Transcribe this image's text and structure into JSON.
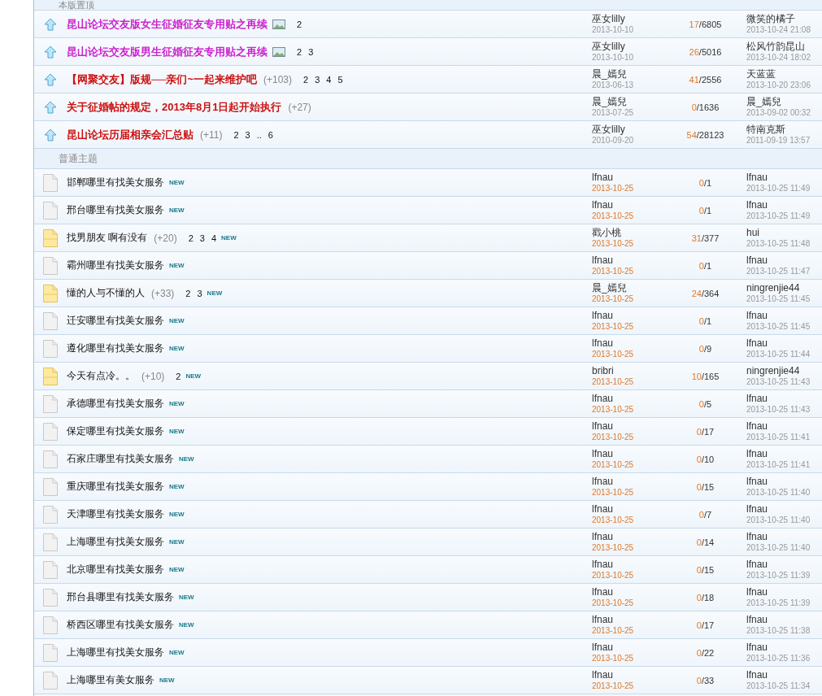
{
  "sections": [
    {
      "kind": "sticky",
      "title": "本版置顶",
      "threads": [
        {
          "kind": "sticky",
          "title": "昆山论坛交友版女生征婚征友专用贴之再续",
          "color": "#cc22cc",
          "attachment": true,
          "pages": [
            "2"
          ],
          "author": "巫女lilly",
          "author_date": "2013-10-10",
          "replies": "17",
          "views": "/6805",
          "last_poster": "微笑的橘子",
          "last_date": "2013-10-24 21:08"
        },
        {
          "kind": "sticky",
          "title": "昆山论坛交友版男生征婚征友专用贴之再续",
          "color": "#cc22cc",
          "attachment": true,
          "pages": [
            "2",
            "3"
          ],
          "author": "巫女lilly",
          "author_date": "2013-10-10",
          "replies": "26",
          "views": "/5016",
          "last_poster": "松风竹韵昆山",
          "last_date": "2013-10-24 18:02"
        },
        {
          "kind": "sticky",
          "title": "【网聚交友】版规──亲们~一起来维护吧",
          "color": "#cc1111",
          "attachment": false,
          "extra": "(+103)",
          "pages": [
            "2",
            "3",
            "4",
            "5"
          ],
          "author": "晨_嫣兒",
          "author_date": "2013-06-13",
          "replies": "41",
          "views": "/2556",
          "last_poster": "天蓝蓝",
          "last_date": "2013-10-20 23:06"
        },
        {
          "kind": "sticky",
          "title": "关于征婚帖的规定，2013年8月1日起开始执行",
          "color": "#cc1111",
          "attachment": false,
          "extra": "(+27)",
          "author": "晨_嫣兒",
          "author_date": "2013-07-25",
          "replies": "0",
          "views": "/1636",
          "last_poster": "晨_嫣兒",
          "last_date": "2013-09-02 00:32"
        },
        {
          "kind": "sticky",
          "title": "昆山论坛历届相亲会汇总贴",
          "color": "#cc1111",
          "attachment": false,
          "extra": "(+11)",
          "pages": [
            "2",
            "3",
            "..",
            "6"
          ],
          "author": "巫女lilly",
          "author_date": "2010-09-20",
          "replies": "54",
          "views": "/28123",
          "last_poster": "特南克斯",
          "last_date": "2011-09-19 13:57"
        }
      ]
    },
    {
      "kind": "normal",
      "title": "普通主题",
      "threads": [
        {
          "kind": "normal",
          "title": "邯郸哪里有找美女服务",
          "badge": "NEW",
          "author": "lfnau",
          "author_date": "2013-10-25",
          "replies": "0",
          "views": "/1",
          "last_poster": "lfnau",
          "last_date": "2013-10-25 11:49"
        },
        {
          "kind": "normal",
          "title": "邢台哪里有找美女服务",
          "badge": "NEW",
          "author": "lfnau",
          "author_date": "2013-10-25",
          "replies": "0",
          "views": "/1",
          "last_poster": "lfnau",
          "last_date": "2013-10-25 11:49"
        },
        {
          "kind": "hot",
          "title": "找男朋友 啊有没有",
          "extra": "(+20)",
          "pages": [
            "2",
            "3",
            "4"
          ],
          "badge": "NEW",
          "author": "戳小桃",
          "author_date": "2013-10-25",
          "replies": "31",
          "views": "/377",
          "last_poster": "hui",
          "last_date": "2013-10-25 11:48"
        },
        {
          "kind": "normal",
          "title": "霸州哪里有找美女服务",
          "badge": "NEW",
          "author": "lfnau",
          "author_date": "2013-10-25",
          "replies": "0",
          "views": "/1",
          "last_poster": "lfnau",
          "last_date": "2013-10-25 11:47"
        },
        {
          "kind": "hot",
          "title": "懂的人与不懂的人",
          "extra": "(+33)",
          "pages": [
            "2",
            "3"
          ],
          "badge": "NEW",
          "author": "晨_嫣兒",
          "author_date": "2013-10-25",
          "replies": "24",
          "views": "/364",
          "last_poster": "ningrenjie44",
          "last_date": "2013-10-25 11:45"
        },
        {
          "kind": "normal",
          "title": "迁安哪里有找美女服务",
          "badge": "NEW",
          "author": "lfnau",
          "author_date": "2013-10-25",
          "replies": "0",
          "views": "/1",
          "last_poster": "lfnau",
          "last_date": "2013-10-25 11:45"
        },
        {
          "kind": "normal",
          "title": "遵化哪里有找美女服务",
          "badge": "NEW",
          "author": "lfnau",
          "author_date": "2013-10-25",
          "replies": "0",
          "views": "/9",
          "last_poster": "lfnau",
          "last_date": "2013-10-25 11:44"
        },
        {
          "kind": "hot",
          "title": "今天有点冷。。",
          "extra": "(+10)",
          "pages": [
            "2"
          ],
          "badge": "NEW",
          "author": "bribri",
          "author_date": "2013-10-25",
          "replies": "10",
          "views": "/165",
          "last_poster": "ningrenjie44",
          "last_date": "2013-10-25 11:43"
        },
        {
          "kind": "normal",
          "title": "承德哪里有找美女服务",
          "badge": "NEW",
          "author": "lfnau",
          "author_date": "2013-10-25",
          "replies": "0",
          "views": "/5",
          "last_poster": "lfnau",
          "last_date": "2013-10-25 11:43"
        },
        {
          "kind": "normal",
          "title": "保定哪里有找美女服务",
          "badge": "NEW",
          "author": "lfnau",
          "author_date": "2013-10-25",
          "replies": "0",
          "views": "/17",
          "last_poster": "lfnau",
          "last_date": "2013-10-25 11:41"
        },
        {
          "kind": "normal",
          "title": "石家庄哪里有找美女服务",
          "badge": "NEW",
          "author": "lfnau",
          "author_date": "2013-10-25",
          "replies": "0",
          "views": "/10",
          "last_poster": "lfnau",
          "last_date": "2013-10-25 11:41"
        },
        {
          "kind": "normal",
          "title": "重庆哪里有找美女服务",
          "badge": "NEW",
          "author": "lfnau",
          "author_date": "2013-10-25",
          "replies": "0",
          "views": "/15",
          "last_poster": "lfnau",
          "last_date": "2013-10-25 11:40"
        },
        {
          "kind": "normal",
          "title": "天津哪里有找美女服务",
          "badge": "NEW",
          "author": "lfnau",
          "author_date": "2013-10-25",
          "replies": "0",
          "views": "/7",
          "last_poster": "lfnau",
          "last_date": "2013-10-25 11:40"
        },
        {
          "kind": "normal",
          "title": "上海哪里有找美女服务",
          "badge": "NEW",
          "author": "lfnau",
          "author_date": "2013-10-25",
          "replies": "0",
          "views": "/14",
          "last_poster": "lfnau",
          "last_date": "2013-10-25 11:40"
        },
        {
          "kind": "normal",
          "title": "北京哪里有找美女服务",
          "badge": "NEW",
          "author": "lfnau",
          "author_date": "2013-10-25",
          "replies": "0",
          "views": "/15",
          "last_poster": "lfnau",
          "last_date": "2013-10-25 11:39"
        },
        {
          "kind": "normal",
          "title": "邢台县哪里有找美女服务",
          "badge": "NEW",
          "author": "lfnau",
          "author_date": "2013-10-25",
          "replies": "0",
          "views": "/18",
          "last_poster": "lfnau",
          "last_date": "2013-10-25 11:39"
        },
        {
          "kind": "normal",
          "title": "桥西区哪里有找美女服务",
          "badge": "NEW",
          "author": "lfnau",
          "author_date": "2013-10-25",
          "replies": "0",
          "views": "/17",
          "last_poster": "lfnau",
          "last_date": "2013-10-25 11:38"
        },
        {
          "kind": "normal",
          "title": "上海哪里有找美女服务",
          "badge": "NEW",
          "author": "lfnau",
          "author_date": "2013-10-25",
          "replies": "0",
          "views": "/22",
          "last_poster": "lfnau",
          "last_date": "2013-10-25 11:36"
        },
        {
          "kind": "normal",
          "title": "上海哪里有美女服务",
          "badge": "NEW",
          "author": "lfnau",
          "author_date": "2013-10-25",
          "replies": "0",
          "views": "/33",
          "last_poster": "lfnau",
          "last_date": "2013-10-25 11:34"
        }
      ]
    }
  ]
}
